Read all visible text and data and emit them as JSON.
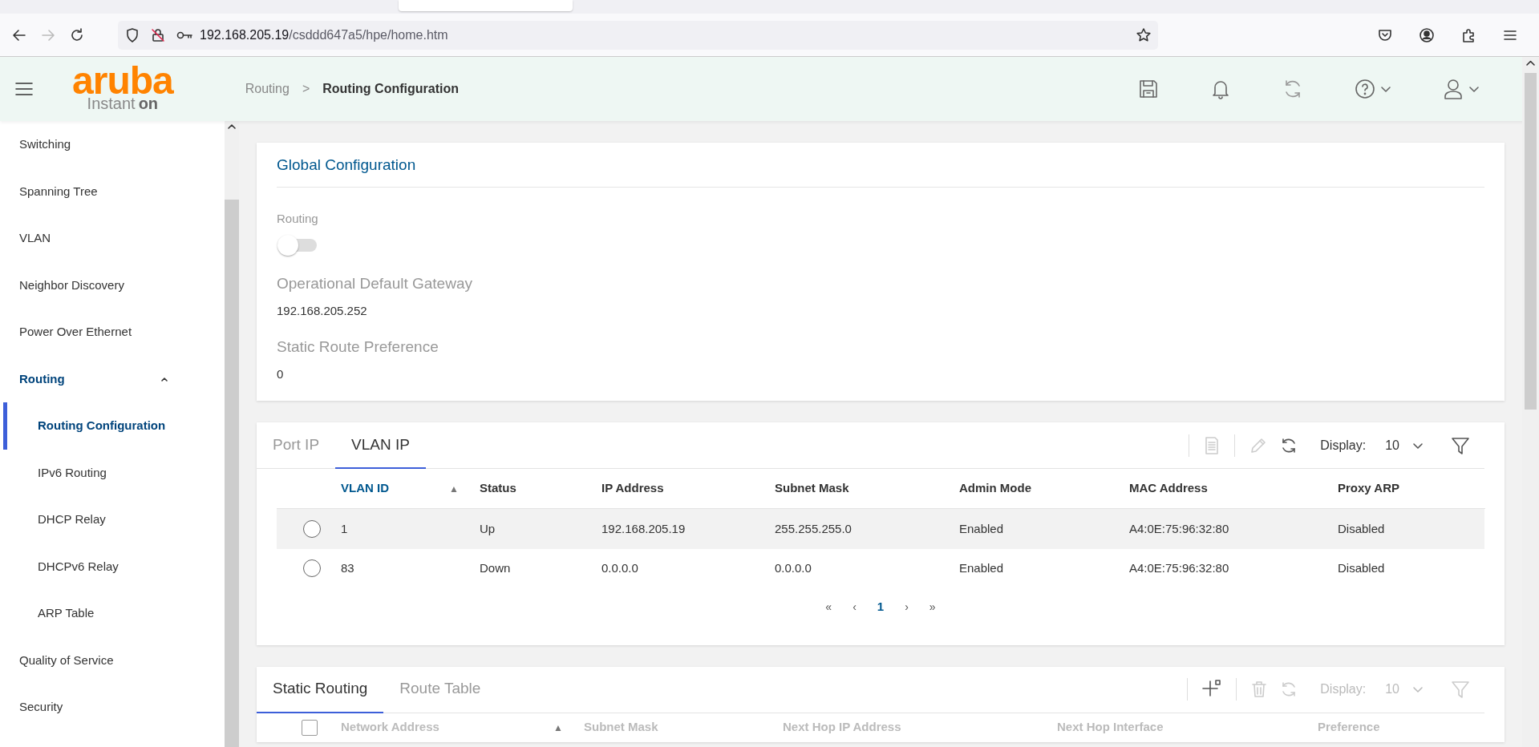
{
  "browser": {
    "url_host": "192.168.205.19",
    "url_path": "/csddd647a5/hpe/home.htm",
    "forward_disabled": true
  },
  "header": {
    "logo": {
      "brand": "aruba",
      "product": "Instant",
      "badge": "on"
    },
    "breadcrumb": [
      {
        "label": "Routing",
        "current": false
      },
      {
        "label": "Routing Configuration",
        "current": true
      }
    ],
    "breadcrumb_separator": ">"
  },
  "sidebar": {
    "items": [
      {
        "label": "Switching",
        "selected": false
      },
      {
        "label": "Spanning Tree",
        "selected": false
      },
      {
        "label": "VLAN",
        "selected": false
      },
      {
        "label": "Neighbor Discovery",
        "selected": false
      },
      {
        "label": "Power Over Ethernet",
        "selected": false
      },
      {
        "label": "Routing",
        "selected": false,
        "expanded": true,
        "children": [
          {
            "label": "Routing Configuration",
            "selected": true
          },
          {
            "label": "IPv6 Routing",
            "selected": false
          },
          {
            "label": "DHCP Relay",
            "selected": false
          },
          {
            "label": "DHCPv6 Relay",
            "selected": false
          },
          {
            "label": "ARP Table",
            "selected": false
          }
        ]
      },
      {
        "label": "Quality of Service",
        "selected": false
      },
      {
        "label": "Security",
        "selected": false
      }
    ]
  },
  "global_config": {
    "title": "Global Configuration",
    "routing": {
      "label": "Routing",
      "on": false
    },
    "fields": [
      {
        "label": "Operational Default Gateway",
        "value": "192.168.205.252"
      },
      {
        "label": "Static Route Preference",
        "value": "0"
      }
    ]
  },
  "interface_card": {
    "tabs": [
      {
        "label": "Port IP",
        "selected": false
      },
      {
        "label": "VLAN IP",
        "selected": true
      }
    ],
    "toolbar": [
      {
        "kind": "details",
        "disabled": true
      },
      {
        "kind": "edit",
        "disabled": true
      },
      {
        "kind": "refresh",
        "disabled": false
      }
    ],
    "display": {
      "label": "Display:",
      "value": "10",
      "disabled": false
    },
    "filter_disabled": false,
    "columns": [
      {
        "label": "VLAN ID",
        "sorted": true
      },
      {
        "label": "Status",
        "sorted": false
      },
      {
        "label": "IP Address",
        "sorted": false
      },
      {
        "label": "Subnet Mask",
        "sorted": false
      },
      {
        "label": "Admin Mode",
        "sorted": false
      },
      {
        "label": "MAC Address",
        "sorted": false
      },
      {
        "label": "Proxy ARP",
        "sorted": false
      }
    ],
    "sort_indicator": "▲",
    "rows": [
      {
        "selected": false,
        "highlighted": true,
        "cells": [
          "1",
          "Up",
          "192.168.205.19",
          "255.255.255.0",
          "Enabled",
          "A4:0E:75:96:32:80",
          "Disabled"
        ]
      },
      {
        "selected": false,
        "highlighted": false,
        "cells": [
          "83",
          "Down",
          "0.0.0.0",
          "0.0.0.0",
          "Enabled",
          "A4:0E:75:96:32:80",
          "Disabled"
        ]
      }
    ],
    "pagination": [
      {
        "label": "«",
        "current": false
      },
      {
        "label": "‹",
        "current": false
      },
      {
        "label": "1",
        "current": true
      },
      {
        "label": "›",
        "current": false
      },
      {
        "label": "»",
        "current": false
      }
    ]
  },
  "static_card": {
    "tabs": [
      {
        "label": "Static Routing",
        "selected": true
      },
      {
        "label": "Route Table",
        "selected": false
      }
    ],
    "toolbar": [
      {
        "kind": "add",
        "disabled": false
      },
      {
        "kind": "delete",
        "disabled": true
      },
      {
        "kind": "refresh",
        "disabled": true
      }
    ],
    "display": {
      "label": "Display:",
      "value": "10",
      "disabled": true
    },
    "filter_disabled": true,
    "select_all_checked": false,
    "columns": [
      {
        "label": "Network Address",
        "sorted": false
      },
      {
        "label": "Subnet Mask",
        "sorted": false
      },
      {
        "label": "Next Hop IP Address",
        "sorted": false
      },
      {
        "label": "Next Hop Interface",
        "sorted": false
      },
      {
        "label": "Preference",
        "sorted": false
      }
    ],
    "sort_indicator": "▲"
  }
}
